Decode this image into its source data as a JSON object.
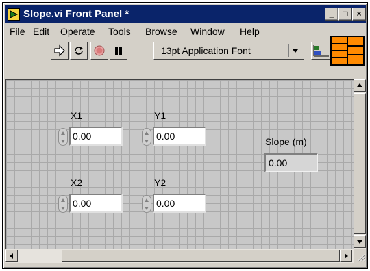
{
  "window": {
    "title": "Slope.vi Front Panel *",
    "minimize_label": "_",
    "maximize_label": "□",
    "close_label": "×"
  },
  "menu": {
    "items": [
      "File",
      "Edit",
      "Operate",
      "Tools",
      "Browse",
      "Window",
      "Help"
    ]
  },
  "toolbar": {
    "font": "13pt Application Font",
    "buttons": [
      "run-arrow-icon",
      "run-continuously-icon",
      "abort-icon",
      "pause-icon"
    ]
  },
  "panel": {
    "controls": {
      "x1": {
        "label": "X1",
        "value": "0.00"
      },
      "y1": {
        "label": "Y1",
        "value": "0.00"
      },
      "x2": {
        "label": "X2",
        "value": "0.00"
      },
      "y2": {
        "label": "Y2",
        "value": "0.00"
      }
    },
    "indicator": {
      "label": "Slope (m)",
      "value": "0.00"
    }
  },
  "colors": {
    "title_bar": "#0a246a",
    "panel_background": "#c8c8c8",
    "grid": "#a9a9a9",
    "connector_pane": "#ff8a00"
  }
}
